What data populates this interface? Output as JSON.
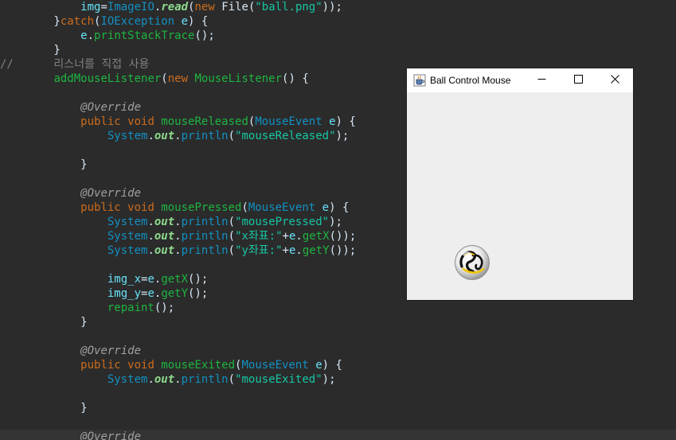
{
  "editor": {
    "lines": [
      {
        "band": false,
        "tokens": [
          {
            "t": "            ",
            "c": "plain"
          },
          {
            "t": "img",
            "c": "var"
          },
          {
            "t": "=",
            "c": "plain"
          },
          {
            "t": "ImageIO",
            "c": "type"
          },
          {
            "t": ".",
            "c": "plain"
          },
          {
            "t": "read",
            "c": "field"
          },
          {
            "t": "(",
            "c": "plain"
          },
          {
            "t": "new",
            "c": "kw"
          },
          {
            "t": " File(",
            "c": "plain"
          },
          {
            "t": "\"ball.png\"",
            "c": "str"
          },
          {
            "t": "));",
            "c": "plain"
          }
        ]
      },
      {
        "band": false,
        "tokens": [
          {
            "t": "        }",
            "c": "plain"
          },
          {
            "t": "catch",
            "c": "kw"
          },
          {
            "t": "(",
            "c": "plain"
          },
          {
            "t": "IOException",
            "c": "type"
          },
          {
            "t": " ",
            "c": "plain"
          },
          {
            "t": "e",
            "c": "var"
          },
          {
            "t": ") {",
            "c": "plain"
          }
        ]
      },
      {
        "band": false,
        "tokens": [
          {
            "t": "            ",
            "c": "plain"
          },
          {
            "t": "e",
            "c": "var"
          },
          {
            "t": ".",
            "c": "plain"
          },
          {
            "t": "printStackTrace",
            "c": "method"
          },
          {
            "t": "();",
            "c": "plain"
          }
        ]
      },
      {
        "band": false,
        "tokens": [
          {
            "t": "        }",
            "c": "plain"
          }
        ]
      },
      {
        "band": false,
        "tokens": [
          {
            "t": "//      리스너를 직접 사용",
            "c": "cmt"
          }
        ]
      },
      {
        "band": false,
        "tokens": [
          {
            "t": "        ",
            "c": "plain"
          },
          {
            "t": "addMouseListener",
            "c": "method"
          },
          {
            "t": "(",
            "c": "plain"
          },
          {
            "t": "new",
            "c": "kw"
          },
          {
            "t": " ",
            "c": "plain"
          },
          {
            "t": "MouseListener",
            "c": "method"
          },
          {
            "t": "() {",
            "c": "plain"
          }
        ]
      },
      {
        "band": false,
        "tokens": []
      },
      {
        "band": false,
        "tokens": [
          {
            "t": "            ",
            "c": "plain"
          },
          {
            "t": "@Override",
            "c": "ann"
          }
        ]
      },
      {
        "band": false,
        "tokens": [
          {
            "t": "            ",
            "c": "plain"
          },
          {
            "t": "public",
            "c": "kw"
          },
          {
            "t": " ",
            "c": "plain"
          },
          {
            "t": "void",
            "c": "kw"
          },
          {
            "t": " ",
            "c": "plain"
          },
          {
            "t": "mouseReleased",
            "c": "method"
          },
          {
            "t": "(",
            "c": "plain"
          },
          {
            "t": "MouseEvent",
            "c": "type"
          },
          {
            "t": " ",
            "c": "plain"
          },
          {
            "t": "e",
            "c": "var"
          },
          {
            "t": ") {",
            "c": "plain"
          }
        ]
      },
      {
        "band": false,
        "tokens": [
          {
            "t": "                ",
            "c": "plain"
          },
          {
            "t": "System",
            "c": "type"
          },
          {
            "t": ".",
            "c": "plain"
          },
          {
            "t": "out",
            "c": "field"
          },
          {
            "t": ".",
            "c": "plain"
          },
          {
            "t": "println",
            "c": "type"
          },
          {
            "t": "(",
            "c": "plain"
          },
          {
            "t": "\"mouseReleased\"",
            "c": "str"
          },
          {
            "t": ");",
            "c": "plain"
          }
        ]
      },
      {
        "band": false,
        "tokens": []
      },
      {
        "band": false,
        "tokens": [
          {
            "t": "            }",
            "c": "plain"
          }
        ]
      },
      {
        "band": false,
        "tokens": []
      },
      {
        "band": false,
        "tokens": [
          {
            "t": "            ",
            "c": "plain"
          },
          {
            "t": "@Override",
            "c": "ann"
          }
        ]
      },
      {
        "band": false,
        "tokens": [
          {
            "t": "            ",
            "c": "plain"
          },
          {
            "t": "public",
            "c": "kw"
          },
          {
            "t": " ",
            "c": "plain"
          },
          {
            "t": "void",
            "c": "kw"
          },
          {
            "t": " ",
            "c": "plain"
          },
          {
            "t": "mousePressed",
            "c": "method"
          },
          {
            "t": "(",
            "c": "plain"
          },
          {
            "t": "MouseEvent",
            "c": "type"
          },
          {
            "t": " ",
            "c": "plain"
          },
          {
            "t": "e",
            "c": "var"
          },
          {
            "t": ") {",
            "c": "plain"
          }
        ]
      },
      {
        "band": false,
        "tokens": [
          {
            "t": "                ",
            "c": "plain"
          },
          {
            "t": "System",
            "c": "type"
          },
          {
            "t": ".",
            "c": "plain"
          },
          {
            "t": "out",
            "c": "field"
          },
          {
            "t": ".",
            "c": "plain"
          },
          {
            "t": "println",
            "c": "type"
          },
          {
            "t": "(",
            "c": "plain"
          },
          {
            "t": "\"mousePressed\"",
            "c": "str"
          },
          {
            "t": ");",
            "c": "plain"
          }
        ]
      },
      {
        "band": false,
        "tokens": [
          {
            "t": "                ",
            "c": "plain"
          },
          {
            "t": "System",
            "c": "type"
          },
          {
            "t": ".",
            "c": "plain"
          },
          {
            "t": "out",
            "c": "field"
          },
          {
            "t": ".",
            "c": "plain"
          },
          {
            "t": "println",
            "c": "type"
          },
          {
            "t": "(",
            "c": "plain"
          },
          {
            "t": "\"x좌표:\"",
            "c": "str"
          },
          {
            "t": "+",
            "c": "plain"
          },
          {
            "t": "e",
            "c": "var"
          },
          {
            "t": ".",
            "c": "plain"
          },
          {
            "t": "getX",
            "c": "method"
          },
          {
            "t": "());",
            "c": "plain"
          }
        ]
      },
      {
        "band": false,
        "tokens": [
          {
            "t": "                ",
            "c": "plain"
          },
          {
            "t": "System",
            "c": "type"
          },
          {
            "t": ".",
            "c": "plain"
          },
          {
            "t": "out",
            "c": "field"
          },
          {
            "t": ".",
            "c": "plain"
          },
          {
            "t": "println",
            "c": "type"
          },
          {
            "t": "(",
            "c": "plain"
          },
          {
            "t": "\"y좌표:\"",
            "c": "str"
          },
          {
            "t": "+",
            "c": "plain"
          },
          {
            "t": "e",
            "c": "var"
          },
          {
            "t": ".",
            "c": "plain"
          },
          {
            "t": "getY",
            "c": "method"
          },
          {
            "t": "());",
            "c": "plain"
          }
        ]
      },
      {
        "band": false,
        "tokens": []
      },
      {
        "band": false,
        "tokens": [
          {
            "t": "                ",
            "c": "plain"
          },
          {
            "t": "img_x",
            "c": "var"
          },
          {
            "t": "=",
            "c": "plain"
          },
          {
            "t": "e",
            "c": "var"
          },
          {
            "t": ".",
            "c": "plain"
          },
          {
            "t": "getX",
            "c": "method"
          },
          {
            "t": "();",
            "c": "plain"
          }
        ]
      },
      {
        "band": false,
        "tokens": [
          {
            "t": "                ",
            "c": "plain"
          },
          {
            "t": "img_y",
            "c": "var"
          },
          {
            "t": "=",
            "c": "plain"
          },
          {
            "t": "e",
            "c": "var"
          },
          {
            "t": ".",
            "c": "plain"
          },
          {
            "t": "getY",
            "c": "method"
          },
          {
            "t": "();",
            "c": "plain"
          }
        ]
      },
      {
        "band": false,
        "tokens": [
          {
            "t": "                ",
            "c": "plain"
          },
          {
            "t": "repaint",
            "c": "method"
          },
          {
            "t": "();",
            "c": "plain"
          }
        ]
      },
      {
        "band": false,
        "tokens": [
          {
            "t": "            }",
            "c": "plain"
          }
        ]
      },
      {
        "band": false,
        "tokens": []
      },
      {
        "band": false,
        "tokens": [
          {
            "t": "            ",
            "c": "plain"
          },
          {
            "t": "@Override",
            "c": "ann"
          }
        ]
      },
      {
        "band": false,
        "tokens": [
          {
            "t": "            ",
            "c": "plain"
          },
          {
            "t": "public",
            "c": "kw"
          },
          {
            "t": " ",
            "c": "plain"
          },
          {
            "t": "void",
            "c": "kw"
          },
          {
            "t": " ",
            "c": "plain"
          },
          {
            "t": "mouseExited",
            "c": "method"
          },
          {
            "t": "(",
            "c": "plain"
          },
          {
            "t": "MouseEvent",
            "c": "type"
          },
          {
            "t": " ",
            "c": "plain"
          },
          {
            "t": "e",
            "c": "var"
          },
          {
            "t": ") {",
            "c": "plain"
          }
        ]
      },
      {
        "band": false,
        "tokens": [
          {
            "t": "                ",
            "c": "plain"
          },
          {
            "t": "System",
            "c": "type"
          },
          {
            "t": ".",
            "c": "plain"
          },
          {
            "t": "out",
            "c": "field"
          },
          {
            "t": ".",
            "c": "plain"
          },
          {
            "t": "println",
            "c": "type"
          },
          {
            "t": "(",
            "c": "plain"
          },
          {
            "t": "\"mouseExited\"",
            "c": "str"
          },
          {
            "t": ");",
            "c": "plain"
          }
        ]
      },
      {
        "band": false,
        "tokens": []
      },
      {
        "band": false,
        "tokens": [
          {
            "t": "            }",
            "c": "plain"
          }
        ]
      },
      {
        "band": false,
        "tokens": []
      },
      {
        "band": true,
        "tokens": [
          {
            "t": "            ",
            "c": "plain"
          },
          {
            "t": "@Override",
            "c": "ann"
          }
        ]
      }
    ]
  },
  "window": {
    "title": "Ball Control Mouse",
    "icon": "java-cup-icon",
    "controls": {
      "minimize": "minimize-icon",
      "maximize": "maximize-icon",
      "close": "close-icon"
    },
    "content": {
      "image": "ball-icon"
    }
  }
}
